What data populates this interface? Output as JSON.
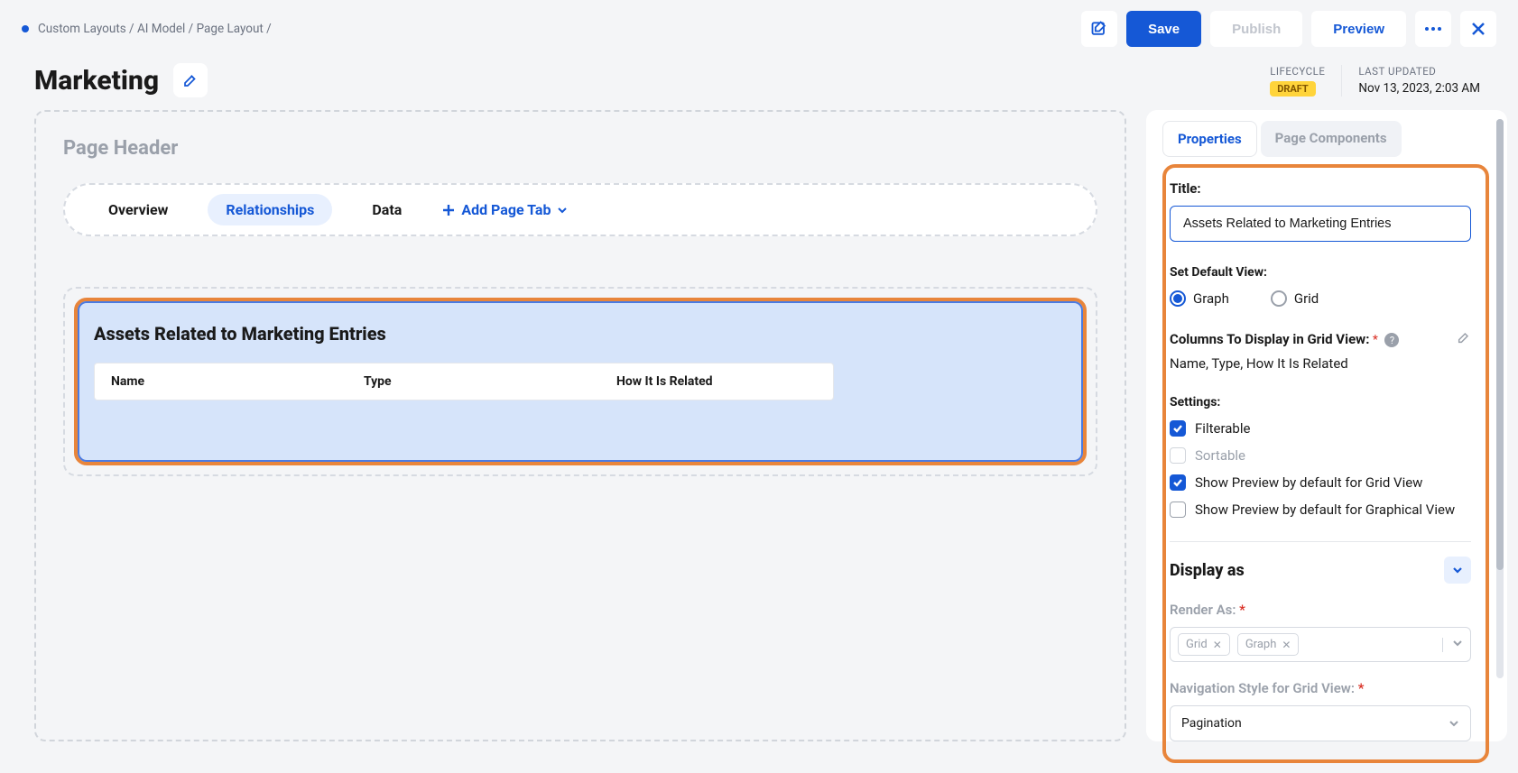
{
  "breadcrumb": {
    "path": "Custom Layouts / AI Model / Page Layout /"
  },
  "toolbar": {
    "save_label": "Save",
    "publish_label": "Publish",
    "preview_label": "Preview"
  },
  "title": {
    "text": "Marketing"
  },
  "meta": {
    "lifecycle_label": "LIFECYCLE",
    "lifecycle_value": "DRAFT",
    "last_updated_label": "LAST UPDATED",
    "last_updated_value": "Nov 13, 2023, 2:03 AM"
  },
  "canvas": {
    "page_header_label": "Page Header",
    "tabs": [
      {
        "label": "Overview"
      },
      {
        "label": "Relationships"
      },
      {
        "label": "Data"
      }
    ],
    "active_tab_index": 1,
    "add_tab_label": "Add Page Tab",
    "card": {
      "title": "Assets Related to Marketing Entries",
      "columns": [
        "Name",
        "Type",
        "How It Is Related"
      ]
    }
  },
  "panel": {
    "tabs": {
      "properties": "Properties",
      "components": "Page Components"
    },
    "title_label": "Title:",
    "title_value": "Assets Related to Marketing Entries",
    "default_view_label": "Set Default View:",
    "radios": {
      "graph": "Graph",
      "grid": "Grid",
      "selected": "graph"
    },
    "columns_label": "Columns To Display in Grid View:",
    "columns_value": "Name, Type, How It Is Related",
    "settings_label": "Settings:",
    "checks": {
      "filterable": {
        "label": "Filterable",
        "checked": true,
        "disabled": false
      },
      "sortable": {
        "label": "Sortable",
        "checked": false,
        "disabled": true
      },
      "preview_grid": {
        "label": "Show Preview by default for Grid View",
        "checked": true,
        "disabled": false
      },
      "preview_graph": {
        "label": "Show Preview by default for Graphical View",
        "checked": false,
        "disabled": false
      }
    },
    "display_as_label": "Display as",
    "render_as_label": "Render As:",
    "render_tags": [
      "Grid",
      "Graph"
    ],
    "nav_style_label": "Navigation Style for Grid View:",
    "nav_style_value": "Pagination"
  }
}
